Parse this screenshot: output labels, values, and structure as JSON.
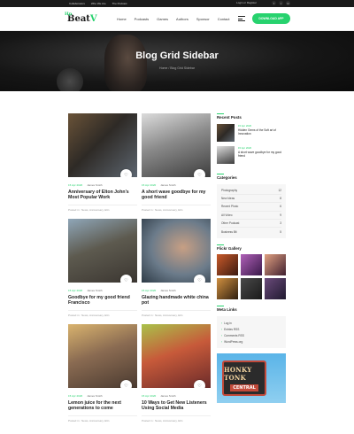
{
  "topbar": {
    "links": [
      "Collaborators",
      "Who We Are",
      "The Podcast"
    ],
    "login": "Login or Register"
  },
  "header": {
    "logo_text": "Beat",
    "logo_accent": "V",
    "logo_badge": "Hp",
    "nav": [
      "Home",
      "Podcasts",
      "Games",
      "Authors",
      "Sponsor",
      "Contact"
    ],
    "download_label": "DOWNLOAD APP",
    "socials": [
      "f",
      "t",
      "in"
    ]
  },
  "hero": {
    "title": "Blog Grid Sidebar",
    "breadcrumb": "Home / Blog Grid Sidebar"
  },
  "posts": [
    {
      "date": "15 Apr 2020",
      "author": "James Smith",
      "title": "Anniversary of Elton John's Most Popular Work",
      "posted": "Posted in : News, Anniversary, Eltn"
    },
    {
      "date": "15 Apr 2020",
      "author": "James Smith",
      "title": "A short wave goodbye for my good friend",
      "posted": "Posted in : News, Anniversary, Eltn"
    },
    {
      "date": "15 Apr 2020",
      "author": "James Smith",
      "title": "Goodbye for my good friend Francisco",
      "posted": "Posted in : News, Anniversary, Eltn"
    },
    {
      "date": "15 Apr 2020",
      "author": "James Smith",
      "title": "Glazing handmade white china pot",
      "posted": "Posted in : News, Anniversary, Eltn"
    },
    {
      "date": "15 Apr 2020",
      "author": "James Smith",
      "title": "Lemon juice for the next generations to come",
      "posted": "Posted in : News, Anniversary, Eltn"
    },
    {
      "date": "15 Apr 2020",
      "author": "James Smith",
      "title": "10 Ways to Get New Listeners Using Social Media",
      "posted": "Posted in : News, Anniversary, Eltn"
    }
  ],
  "sidebar": {
    "recent_title": "Recent Posts",
    "recent": [
      {
        "date": "15 Apr 2020",
        "title": "Hidden Gems of the Soft art of Innovation"
      },
      {
        "date": "15 Apr 2020",
        "title": "A short wave goodbye for my good friend"
      }
    ],
    "categories_title": "Categories",
    "categories": [
      {
        "name": "Photography",
        "count": "12"
      },
      {
        "name": "New Ideas",
        "count": "8"
      },
      {
        "name": "Recent Photo",
        "count": "6"
      },
      {
        "name": "All Video",
        "count": "9"
      },
      {
        "name": "Other Podcast",
        "count": "3"
      },
      {
        "name": "Business Bit",
        "count": "5"
      }
    ],
    "flickr_title": "Flickr Gallery",
    "meta_title": "Meta Links",
    "meta": [
      "Log in",
      "Entries RSS",
      "Comments RSS",
      "WordPress.org"
    ],
    "banner_line1": "HONKY TONK",
    "banner_line2": "CENTRAL"
  },
  "colors": {
    "accent": "#27d26e",
    "dark": "#1a1a1a"
  }
}
